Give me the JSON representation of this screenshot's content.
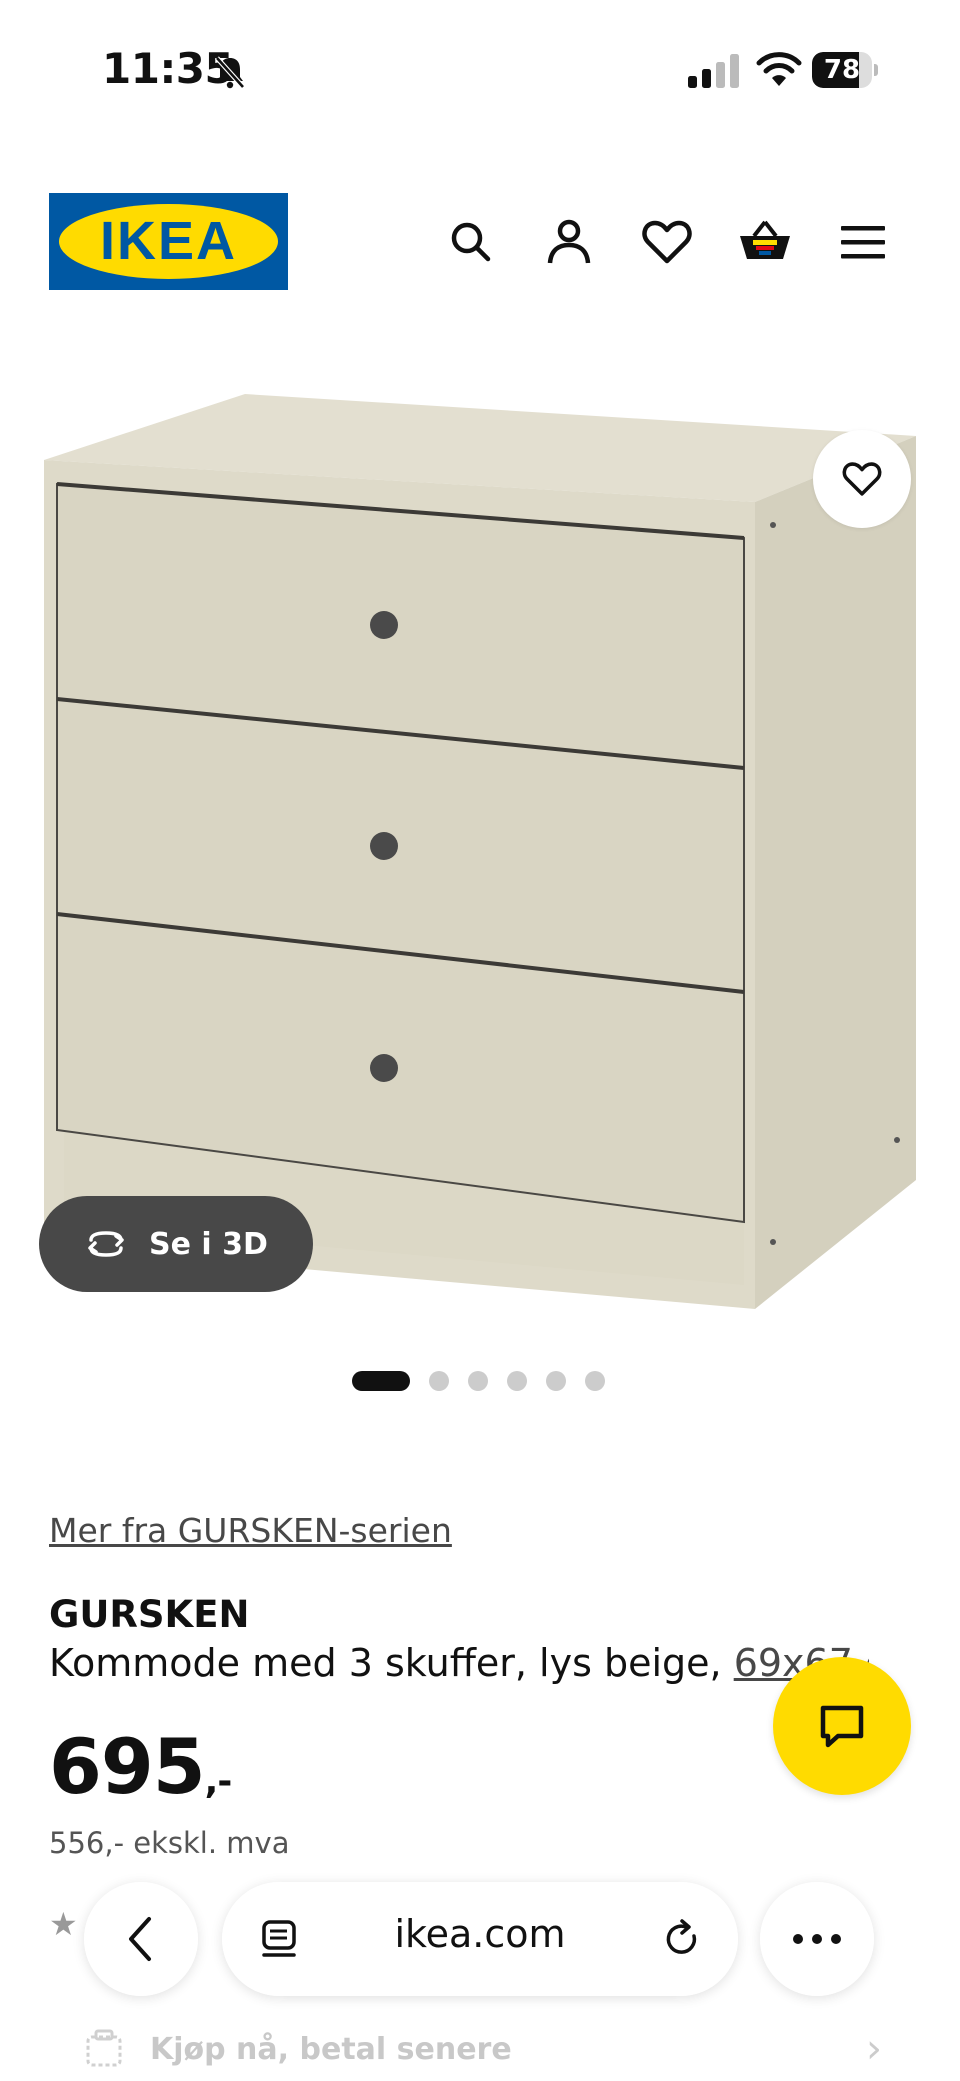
{
  "status_bar": {
    "time": "11:35",
    "battery": "78",
    "battery_level": 0.78
  },
  "header": {
    "logo_text": "IKEA",
    "icons": [
      "search-icon",
      "account-icon",
      "favourites-icon",
      "basket-icon",
      "menu-icon"
    ]
  },
  "gallery": {
    "view_3d_label": "Se i 3D",
    "image_count": 6,
    "active_index": 0
  },
  "product": {
    "series_link": "Mer fra GURSKEN-serien",
    "name": "GURSKEN",
    "description": "Kommode med 3 skuffer, lys beige, ",
    "size_link": "69x67 cm",
    "price_main": "695",
    "price_suffix": ",-",
    "price_ex_vat": "556,- ekskl. mva"
  },
  "payment": {
    "bnpl_label": "Kjøp nå, betal senere"
  },
  "browser": {
    "domain": "ikea.com"
  },
  "colors": {
    "ikea_blue": "#0058a3",
    "ikea_yellow": "#ffdb00",
    "product_beige": "#ddd9c8"
  }
}
